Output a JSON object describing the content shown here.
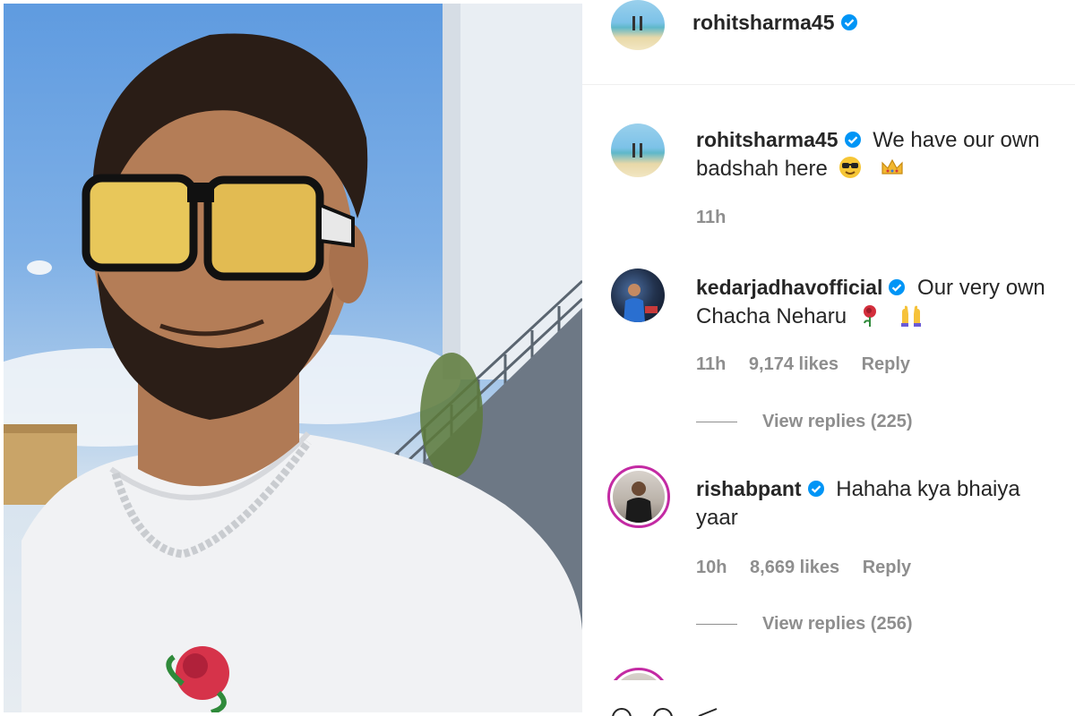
{
  "post_header": {
    "username": "rohitsharma45"
  },
  "comments": [
    {
      "username": "rohitsharma45",
      "text": "We have our own badshah here",
      "emojis": [
        "smiling-face-with-sunglasses",
        "crown"
      ],
      "time": "11h"
    },
    {
      "username": "kedarjadhavofficial",
      "text": "Our very own Chacha Neharu",
      "emojis": [
        "rose",
        "raising-hands"
      ],
      "time": "11h",
      "likes": "9,174 likes",
      "reply_label": "Reply",
      "view_replies": "View replies (225)"
    },
    {
      "username": "rishabpant",
      "text": "Hahaha kya bhaiya yaar",
      "time": "10h",
      "likes": "8,669 likes",
      "reply_label": "Reply",
      "view_replies": "View replies (256)"
    }
  ],
  "colors": {
    "verified_blue": "#0095f6",
    "story_ring": "#c32aa3",
    "meta_gray": "#8e8e8e",
    "text": "#262626"
  }
}
